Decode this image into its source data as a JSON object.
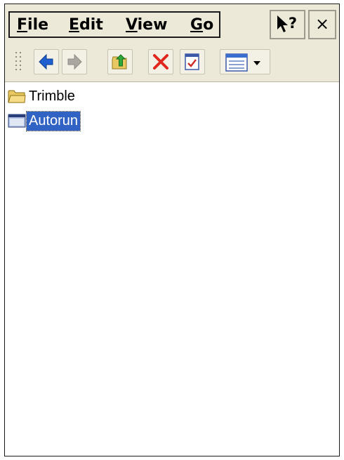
{
  "menu": {
    "items": [
      {
        "accel": "F",
        "rest": "ile"
      },
      {
        "accel": "E",
        "rest": "dit"
      },
      {
        "accel": "V",
        "rest": "iew"
      },
      {
        "accel": "G",
        "rest": "o"
      }
    ]
  },
  "titlebar": {
    "close_glyph": "×"
  },
  "toolbar": {
    "icons": [
      "back-icon",
      "forward-icon",
      "up-folder-icon",
      "delete-icon",
      "properties-icon",
      "view-menu-icon"
    ]
  },
  "files": [
    {
      "name": "Trimble",
      "type": "folder",
      "selected": false
    },
    {
      "name": "Autorun",
      "type": "file",
      "selected": true
    }
  ],
  "colors": {
    "chrome": "#ece9d8",
    "selection": "#3163c5",
    "folder": "#e8c860",
    "back_arrow": "#1f5fd0",
    "delete": "#e0281e"
  }
}
